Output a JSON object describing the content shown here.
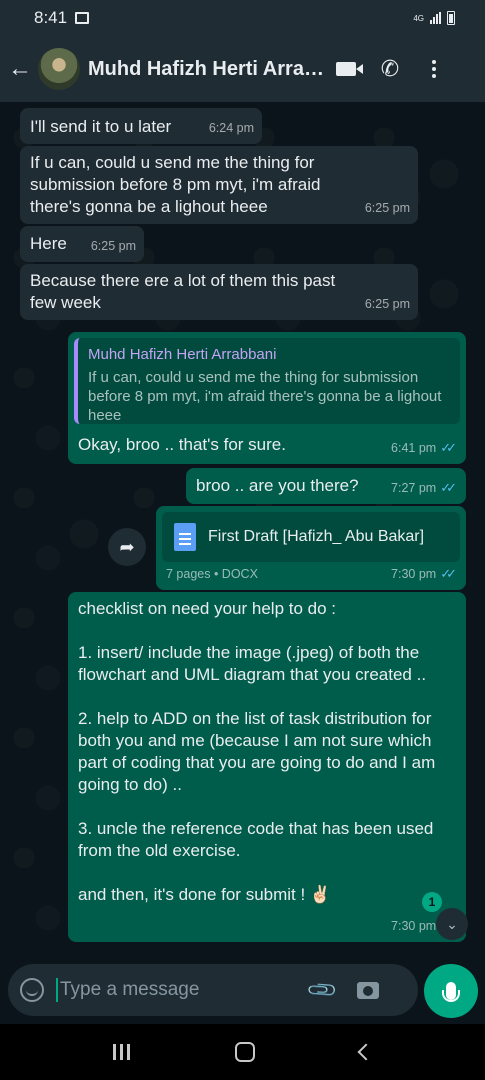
{
  "status_bar": {
    "time": "8:41",
    "network": "4G"
  },
  "header": {
    "contact_name": "Muhd Hafizh Herti Arrabbani"
  },
  "messages": [
    {
      "text": "I'll send it to u later",
      "time": "6:24 pm"
    },
    {
      "text": "If u can, could u send me the thing for submission before 8 pm myt, i'm afraid there's gonna be a lighout heee",
      "time": "6:25 pm"
    },
    {
      "text": "Here",
      "time": "6:25 pm"
    },
    {
      "text": "Because there ere a lot of them this past few week",
      "time": "6:25 pm"
    },
    {
      "quote_name": "Muhd Hafizh Herti Arrabbani",
      "quote_text": "If u can, could u send me the thing for submission before 8 pm myt, i'm afraid there's gonna be a lighout heee",
      "text": "Okay, broo .. that's for sure.",
      "time": "6:41 pm"
    },
    {
      "text": "broo .. are you there?",
      "time": "7:27 pm"
    },
    {
      "doc_name": "First Draft [Hafizh_ Abu Bakar]",
      "doc_meta": "7 pages • DOCX",
      "time": "7:30 pm"
    },
    {
      "lines": [
        "checklist on need your help to do :",
        "1. insert/ include the image (.jpeg) of both the flowchart and UML diagram that you created ..",
        "2. help to ADD on the list of task distribution for both you and me (because I am not sure which part of coding that you are going to do and I am going to do) ..",
        "3. uncle the reference code that has been used from the old exercise.",
        "and then, it's done for submit ! ✌🏻"
      ],
      "time": "7:30 pm"
    }
  ],
  "unread_count": "1",
  "composer": {
    "placeholder": "Type a message"
  },
  "colors": {
    "incoming": "#202c33",
    "outgoing": "#005c4b",
    "accent": "#00a884",
    "read_ticks": "#53bdeb"
  }
}
